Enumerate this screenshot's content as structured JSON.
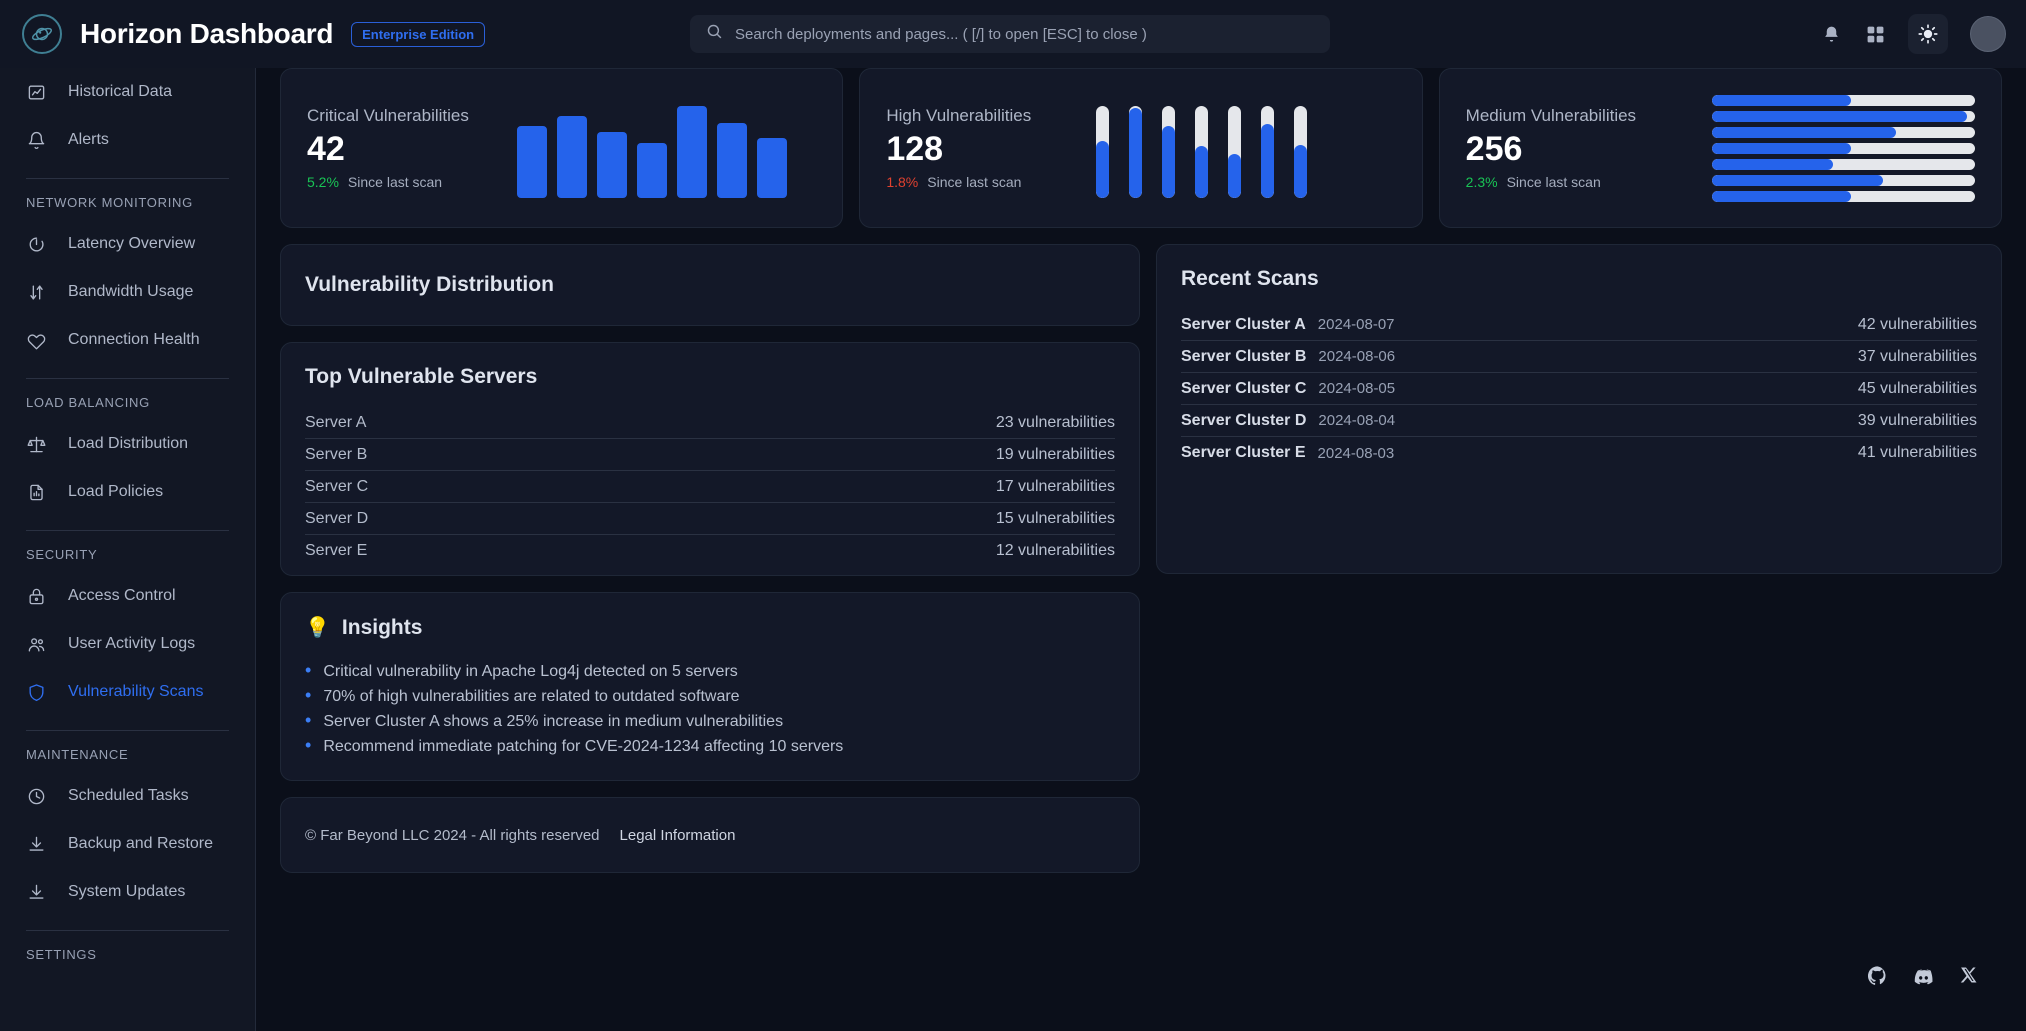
{
  "header": {
    "title": "Horizon Dashboard",
    "badge": "Enterprise Edition",
    "logo_icon": "planet-icon",
    "search": {
      "placeholder": "Search deployments and pages... ( [/] to open [ESC] to close )",
      "value": "",
      "icon": "search-icon"
    },
    "actions": [
      {
        "name": "notifications-icon",
        "label": "Notifications"
      },
      {
        "name": "apps-grid-icon",
        "label": "Apps"
      },
      {
        "name": "theme-toggle-icon",
        "label": "Theme"
      },
      {
        "name": "avatar",
        "label": "Account"
      }
    ]
  },
  "sidebar": {
    "groups": [
      {
        "title": "",
        "items": [
          {
            "label": "Historical Data",
            "icon": "chart-line-icon",
            "active": false
          },
          {
            "label": "Alerts",
            "icon": "bell-icon",
            "active": false
          }
        ]
      },
      {
        "title": "NETWORK MONITORING",
        "items": [
          {
            "label": "Latency Overview",
            "icon": "gauge-icon",
            "active": false
          },
          {
            "label": "Bandwidth Usage",
            "icon": "arrows-updown-icon",
            "active": false
          },
          {
            "label": "Connection Health",
            "icon": "heart-icon",
            "active": false
          }
        ]
      },
      {
        "title": "LOAD BALANCING",
        "items": [
          {
            "label": "Load Distribution",
            "icon": "scales-icon",
            "active": false
          },
          {
            "label": "Load Policies",
            "icon": "file-chart-icon",
            "active": false
          }
        ]
      },
      {
        "title": "SECURITY",
        "items": [
          {
            "label": "Access Control",
            "icon": "lock-icon",
            "active": false
          },
          {
            "label": "User Activity Logs",
            "icon": "users-icon",
            "active": false
          },
          {
            "label": "Vulnerability Scans",
            "icon": "shield-icon",
            "active": true
          }
        ]
      },
      {
        "title": "MAINTENANCE",
        "items": [
          {
            "label": "Scheduled Tasks",
            "icon": "clock-icon",
            "active": false
          },
          {
            "label": "Backup and Restore",
            "icon": "download-icon",
            "active": false
          },
          {
            "label": "System Updates",
            "icon": "download-icon",
            "active": false
          }
        ]
      },
      {
        "title": "SETTINGS",
        "items": []
      }
    ]
  },
  "stats": [
    {
      "label": "Critical Vulnerabilities",
      "value": "42",
      "delta": "5.2%",
      "delta_direction": "up",
      "delta_note": "Since last scan",
      "viz": "bars"
    },
    {
      "label": "High Vulnerabilities",
      "value": "128",
      "delta": "1.8%",
      "delta_direction": "down",
      "delta_note": "Since last scan",
      "viz": "vbars"
    },
    {
      "label": "Medium Vulnerabilities",
      "value": "256",
      "delta": "2.3%",
      "delta_direction": "up",
      "delta_note": "Since last scan",
      "viz": "hbars"
    }
  ],
  "distribution": {
    "title": "Vulnerability Distribution"
  },
  "top_servers": {
    "title": "Top Vulnerable Servers",
    "rows": [
      {
        "name": "Server A",
        "count": "23 vulnerabilities"
      },
      {
        "name": "Server B",
        "count": "19 vulnerabilities"
      },
      {
        "name": "Server C",
        "count": "17 vulnerabilities"
      },
      {
        "name": "Server D",
        "count": "15 vulnerabilities"
      },
      {
        "name": "Server E",
        "count": "12 vulnerabilities"
      }
    ]
  },
  "recent_scans": {
    "title": "Recent Scans",
    "rows": [
      {
        "name": "Server Cluster A",
        "date": "2024-08-07",
        "count": "42 vulnerabilities"
      },
      {
        "name": "Server Cluster B",
        "date": "2024-08-06",
        "count": "37 vulnerabilities"
      },
      {
        "name": "Server Cluster C",
        "date": "2024-08-05",
        "count": "45 vulnerabilities"
      },
      {
        "name": "Server Cluster D",
        "date": "2024-08-04",
        "count": "39 vulnerabilities"
      },
      {
        "name": "Server Cluster E",
        "date": "2024-08-03",
        "count": "41 vulnerabilities"
      }
    ]
  },
  "insights": {
    "title": "Insights",
    "icon": "lightbulb-icon",
    "items": [
      "Critical vulnerability in Apache Log4j detected on 5 servers",
      "70% of high vulnerabilities are related to outdated software",
      "Server Cluster A shows a 25% increase in medium vulnerabilities",
      "Recommend immediate patching for CVE-2024-1234 affecting 10 servers"
    ]
  },
  "footer": {
    "copyright": "© Far Beyond LLC 2024 - All rights reserved",
    "legal_link": "Legal Information",
    "social": [
      {
        "name": "github-icon"
      },
      {
        "name": "discord-icon"
      },
      {
        "name": "x-icon"
      }
    ]
  },
  "colors": {
    "accent": "#2563eb",
    "accent_text": "#2f6ef0",
    "positive": "#19c355",
    "negative": "#e0412f",
    "track": "#e5e7eb",
    "card_bg": "#131828",
    "page_bg": "#0b0f1a",
    "sidebar_bg": "#121724"
  },
  "chart_data": [
    {
      "type": "bar",
      "title": "Critical Vulnerabilities",
      "categories": [
        "1",
        "2",
        "3",
        "4",
        "5",
        "6",
        "7"
      ],
      "values": [
        72,
        82,
        66,
        55,
        92,
        75,
        60
      ],
      "ylim": [
        0,
        100
      ],
      "xlabel": "",
      "ylabel": "",
      "grid": false,
      "legend": "none"
    },
    {
      "type": "bar",
      "title": "High Vulnerabilities",
      "orientation": "vertical-progress",
      "categories": [
        "1",
        "2",
        "3",
        "4",
        "5",
        "6",
        "7"
      ],
      "values": [
        62,
        98,
        78,
        56,
        48,
        80,
        58
      ],
      "ylim": [
        0,
        100
      ],
      "xlabel": "",
      "ylabel": "",
      "grid": false,
      "legend": "none"
    },
    {
      "type": "bar",
      "title": "Medium Vulnerabilities",
      "orientation": "horizontal-progress",
      "categories": [
        "1",
        "2",
        "3",
        "4",
        "5",
        "6",
        "7"
      ],
      "values": [
        53,
        97,
        70,
        53,
        46,
        65,
        53
      ],
      "xlim": [
        0,
        100
      ],
      "xlabel": "",
      "ylabel": "",
      "grid": false,
      "legend": "none"
    },
    {
      "type": "table",
      "title": "Top Vulnerable Servers",
      "categories": [
        "Server A",
        "Server B",
        "Server C",
        "Server D",
        "Server E"
      ],
      "values": [
        23,
        19,
        17,
        15,
        12
      ],
      "ylabel": "vulnerabilities"
    },
    {
      "type": "table",
      "title": "Recent Scans",
      "categories": [
        "Server Cluster A",
        "Server Cluster B",
        "Server Cluster C",
        "Server Cluster D",
        "Server Cluster E"
      ],
      "values": [
        42,
        37,
        45,
        39,
        41
      ],
      "x": [
        "2024-08-07",
        "2024-08-06",
        "2024-08-05",
        "2024-08-04",
        "2024-08-03"
      ],
      "ylabel": "vulnerabilities"
    }
  ]
}
